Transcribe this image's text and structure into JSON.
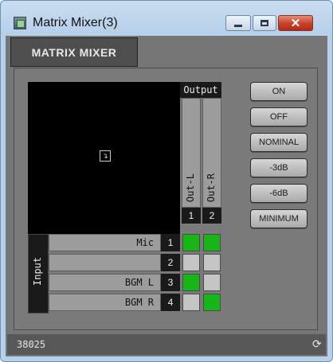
{
  "window": {
    "title": "Matrix Mixer(3)"
  },
  "panel": {
    "header": "MATRIX MIXER",
    "footer_id": "38025"
  },
  "matrix": {
    "output_label": "Output",
    "input_label": "Input",
    "outputs": [
      {
        "label": "Out-L",
        "number": "1"
      },
      {
        "label": "Out-R",
        "number": "2"
      }
    ],
    "inputs": [
      {
        "label": "Mic",
        "number": "1",
        "routes": [
          true,
          true
        ]
      },
      {
        "label": "",
        "number": "2",
        "routes": [
          false,
          false
        ]
      },
      {
        "label": "BGM L",
        "number": "3",
        "routes": [
          true,
          false
        ]
      },
      {
        "label": "BGM R",
        "number": "4",
        "routes": [
          false,
          true
        ]
      }
    ],
    "active_color": "#17b517",
    "inactive_color": "#c5c5c5"
  },
  "buttons": {
    "on": "ON",
    "off": "OFF",
    "nominal": "NOMINAL",
    "minus3": "-3dB",
    "minus6": "-6dB",
    "minimum": "MINIMUM"
  }
}
